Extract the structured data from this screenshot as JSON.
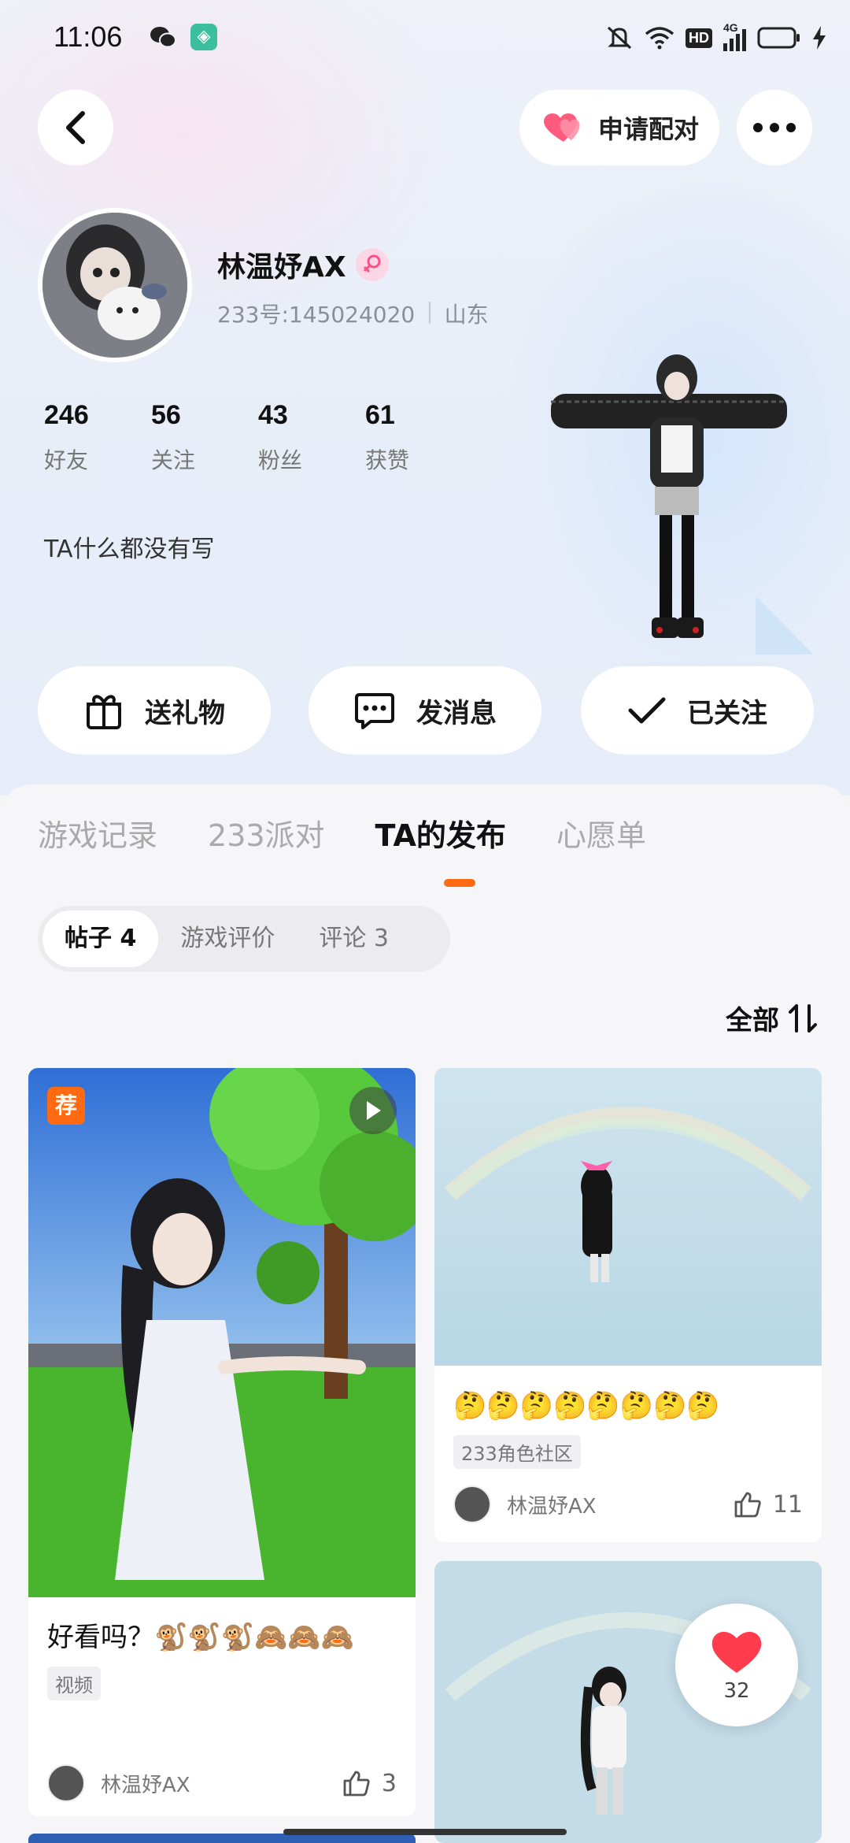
{
  "status_bar": {
    "time": "11:06",
    "icons": [
      "wechat-icon",
      "app-icon",
      "mute-icon",
      "wifi-icon",
      "hd-icon",
      "4g-signal-icon",
      "battery-icon",
      "charging-icon"
    ],
    "hd": "HD",
    "net": "4G"
  },
  "nav": {
    "pair_label": "申请配对"
  },
  "profile": {
    "name": "林温妤AX",
    "id_text": "233号:145024020",
    "location": "山东",
    "stats": [
      {
        "value": "246",
        "label": "好友"
      },
      {
        "value": "56",
        "label": "关注"
      },
      {
        "value": "43",
        "label": "粉丝"
      },
      {
        "value": "61",
        "label": "获赞"
      }
    ],
    "bio": "TA什么都没有写"
  },
  "actions": {
    "gift": "送礼物",
    "message": "发消息",
    "followed": "已关注"
  },
  "tabs": [
    "游戏记录",
    "233派对",
    "TA的发布",
    "心愿单"
  ],
  "active_tab": 2,
  "subtabs": [
    "帖子 4",
    "游戏评价",
    "评论 3"
  ],
  "sort_label": "全部",
  "posts": [
    {
      "badge": "荐",
      "title": "好看吗？🐒🐒🐒🙈🙈🙈",
      "tag": "视频",
      "author": "林温妤AX",
      "likes": "3"
    },
    {
      "title": "🤔🤔🤔🤔🤔🤔🤔🤔",
      "tag": "233角色社区",
      "author": "林温妤AX",
      "likes": "11"
    }
  ],
  "float_like": {
    "count": "32"
  },
  "colors": {
    "accent": "#ff6a13",
    "heart": "#ff3b5c"
  }
}
